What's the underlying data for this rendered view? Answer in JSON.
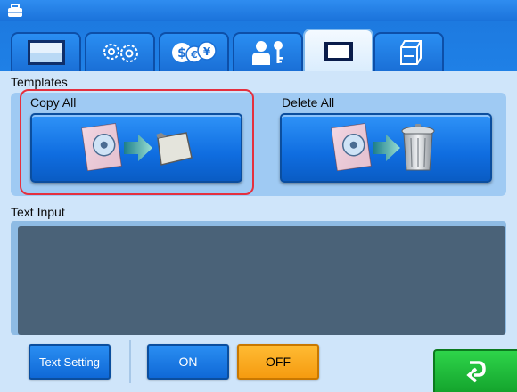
{
  "titlebar": {
    "icon": "toolbox-icon"
  },
  "tabs": [
    {
      "id": "display",
      "icon": "screen-icon",
      "active": false
    },
    {
      "id": "gears",
      "icon": "gears-icon",
      "active": false
    },
    {
      "id": "currency",
      "icon": "currency-icon",
      "active": false
    },
    {
      "id": "user-key",
      "icon": "user-key-icon",
      "active": false
    },
    {
      "id": "frame",
      "icon": "frame-icon",
      "active": true
    },
    {
      "id": "storage",
      "icon": "storage-icon",
      "active": false
    }
  ],
  "templates": {
    "label": "Templates",
    "copy_all": {
      "label": "Copy All",
      "icon": "copy-to-card-icon"
    },
    "delete_all": {
      "label": "Delete All",
      "icon": "delete-to-trash-icon"
    }
  },
  "text_input": {
    "label": "Text Input",
    "value": ""
  },
  "bottom": {
    "text_setting_label": "Text Setting",
    "on_label": "ON",
    "off_label": "OFF",
    "return_icon": "return-arrow-icon"
  },
  "colors": {
    "accent_blue": "#1a7ae0",
    "panel": "#cfe5fa",
    "highlight": "#e5303e",
    "off": "#f7a51f",
    "return": "#14a42d"
  }
}
